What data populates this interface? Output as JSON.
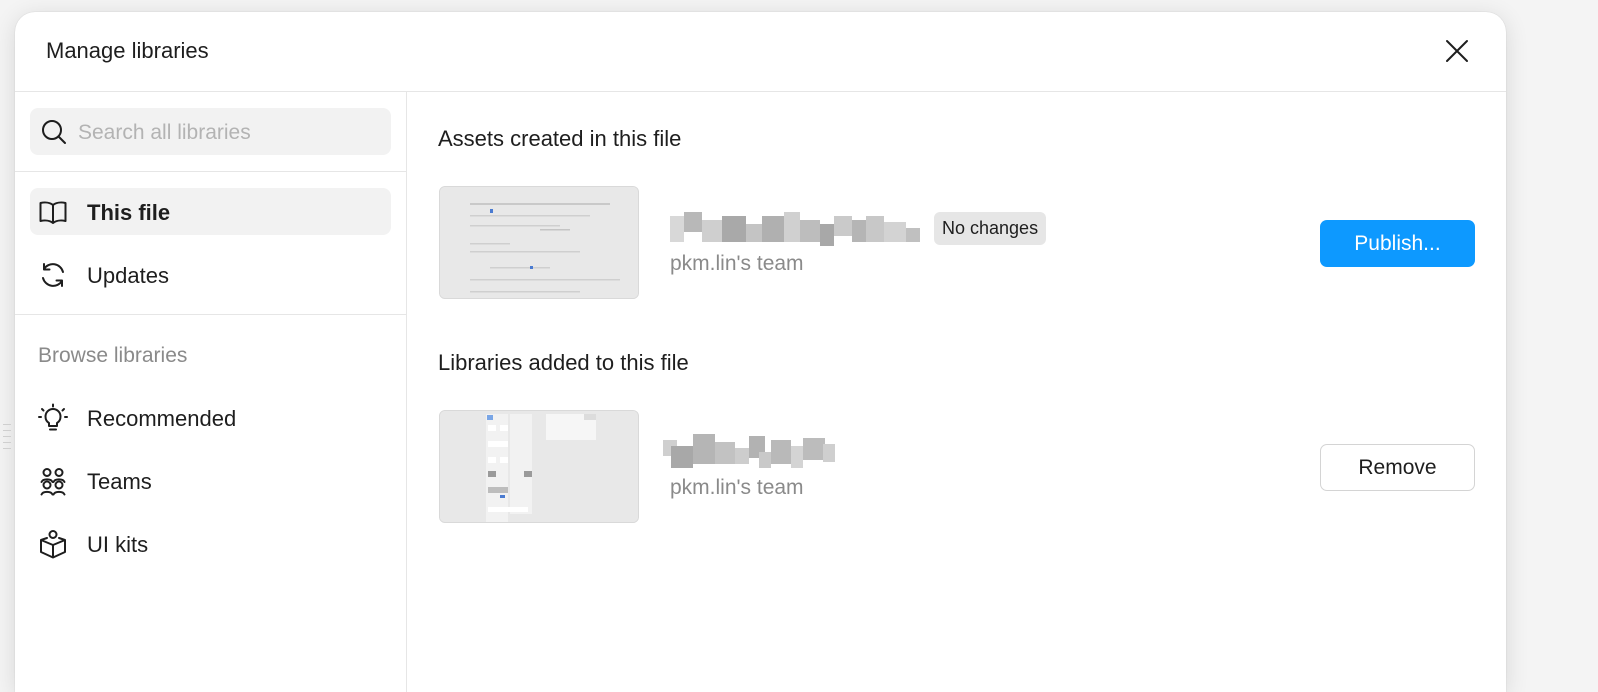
{
  "dialog": {
    "title": "Manage libraries",
    "close_icon": "close-icon"
  },
  "sidebar": {
    "search": {
      "placeholder": "Search all libraries",
      "value": "",
      "icon": "search-icon"
    },
    "items": [
      {
        "label": "This file",
        "icon": "book-icon",
        "active": true
      },
      {
        "label": "Updates",
        "icon": "refresh-icon",
        "active": false
      }
    ],
    "browse_label": "Browse libraries",
    "browse_items": [
      {
        "label": "Recommended",
        "icon": "lightbulb-icon"
      },
      {
        "label": "Teams",
        "icon": "teams-icon"
      },
      {
        "label": "UI kits",
        "icon": "package-icon"
      }
    ]
  },
  "main": {
    "assets_section": {
      "title": "Assets created in this file",
      "library": {
        "name": "",
        "badge": "No changes",
        "team": "pkm.lin's team",
        "action_label": "Publish..."
      }
    },
    "libraries_section": {
      "title": "Libraries added to this file",
      "library": {
        "name": "",
        "team": "pkm.lin's team",
        "action_label": "Remove"
      }
    }
  },
  "colors": {
    "accent": "#0d99ff",
    "muted_text": "#8a8a8a",
    "active_bg": "#f2f2f2",
    "divider": "#e6e6e6"
  }
}
